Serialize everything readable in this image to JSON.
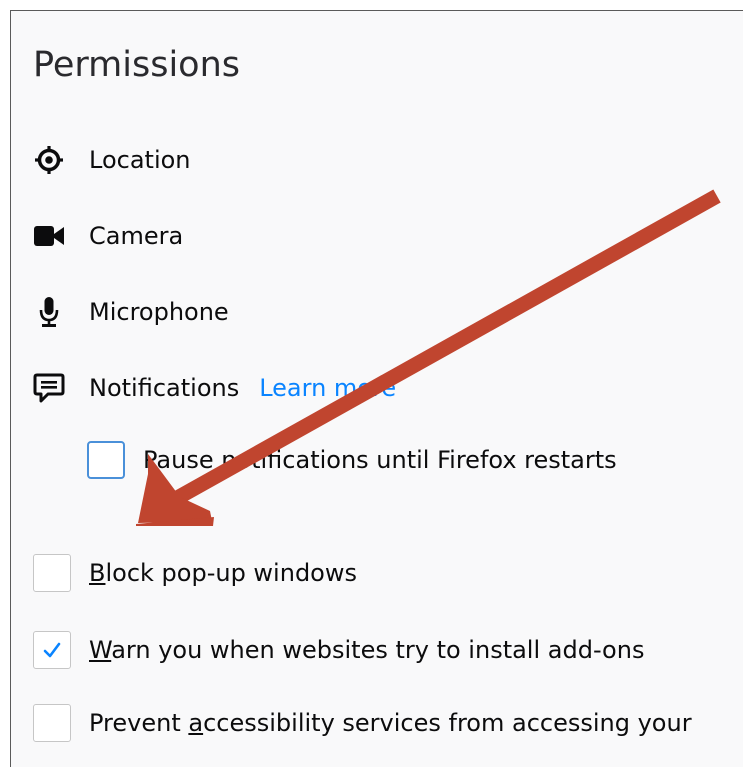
{
  "section": {
    "title": "Permissions"
  },
  "permissions": [
    {
      "label": "Location",
      "icon": "location-icon"
    },
    {
      "label": "Camera",
      "icon": "camera-icon"
    },
    {
      "label": "Microphone",
      "icon": "microphone-icon"
    },
    {
      "label": "Notifications",
      "icon": "notification-icon"
    }
  ],
  "notifications": {
    "learn_more": "Learn more",
    "pause_label": "Pause notifications until Firefox restarts",
    "pause_checked": false
  },
  "checkboxes": {
    "block_popups": {
      "accesskey": "B",
      "rest": "lock pop-up windows",
      "checked": false
    },
    "warn_addons": {
      "accesskey": "W",
      "rest": "arn you when websites try to install add-ons",
      "checked": true
    },
    "prevent_a11y": {
      "prefix": "Prevent ",
      "accesskey": "a",
      "rest": "ccessibility services from accessing your",
      "checked": false
    }
  },
  "colors": {
    "link": "#0a84ff",
    "arrow": "#c0452f",
    "checkmark": "#0a84ff"
  }
}
